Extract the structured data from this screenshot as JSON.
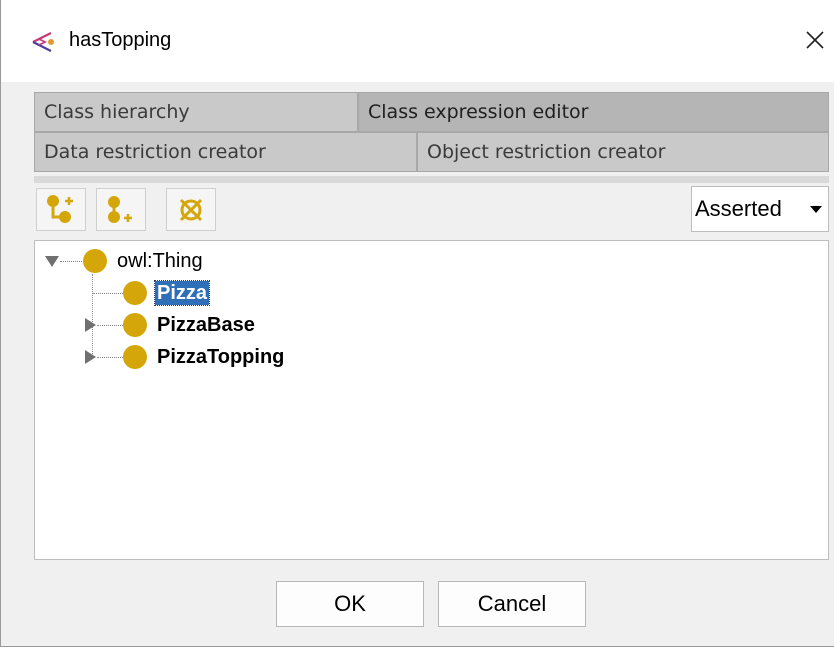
{
  "window": {
    "title": "hasTopping",
    "close_glyph": "✕",
    "icon": "protege-property-icon"
  },
  "tabs": [
    {
      "label": "Class hierarchy",
      "selected": false
    },
    {
      "label": "Class expression editor",
      "selected": true
    },
    {
      "label": "Data restriction creator",
      "selected": false
    },
    {
      "label": "Object restriction creator",
      "selected": false
    }
  ],
  "toolbar": {
    "buttons": [
      {
        "icon": "add-subclass-icon"
      },
      {
        "icon": "add-sibling-class-icon"
      },
      {
        "icon": "delete-class-icon"
      }
    ],
    "view_mode": "Asserted"
  },
  "tree": {
    "root": {
      "label": "owl:Thing",
      "expanded": true
    },
    "children": [
      {
        "label": "Pizza",
        "bold": true,
        "selected": true,
        "has_children": false
      },
      {
        "label": "PizzaBase",
        "bold": true,
        "selected": false,
        "has_children": true
      },
      {
        "label": "PizzaTopping",
        "bold": true,
        "selected": false,
        "has_children": true
      }
    ],
    "class_color": "#d4a60a",
    "selection_color": "#2f6fb8"
  },
  "buttons": {
    "ok": "OK",
    "cancel": "Cancel"
  }
}
